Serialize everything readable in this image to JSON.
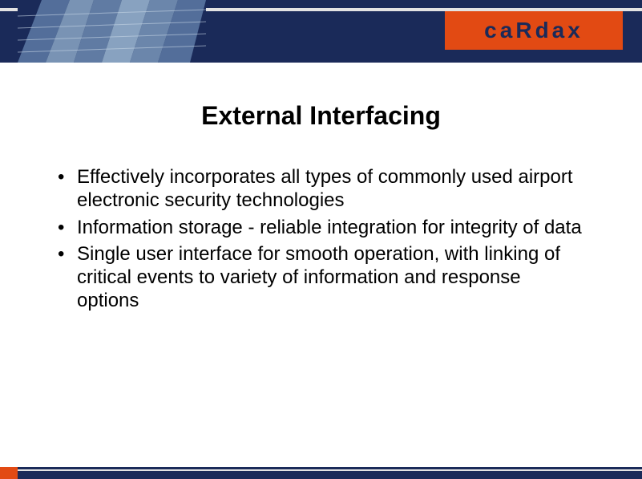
{
  "brand": {
    "name": "cardax"
  },
  "slide": {
    "title": "External Interfacing",
    "bullets": [
      "Effectively incorporates all types of commonly used airport electronic security technologies",
      "Information storage - reliable integration for integrity of data",
      "Single user interface for smooth operation, with linking of critical events to variety of information and response options"
    ]
  }
}
